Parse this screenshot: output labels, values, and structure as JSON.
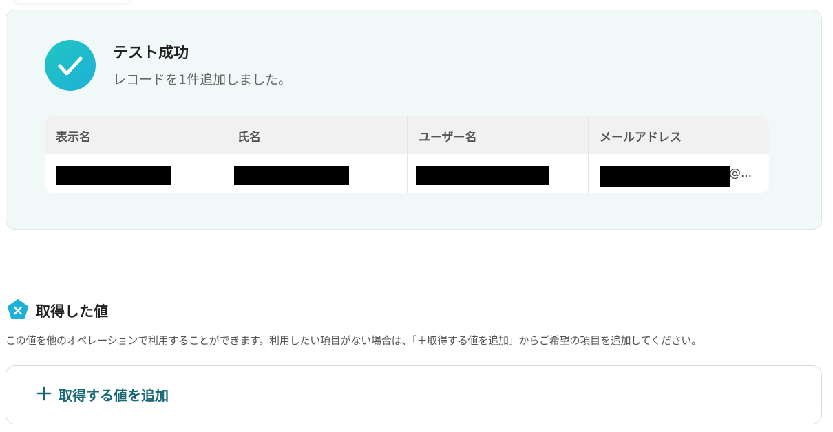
{
  "result": {
    "title": "テスト成功",
    "message": "レコードを1件追加しました。"
  },
  "table": {
    "columns": [
      "表示名",
      "氏名",
      "ユーザー名",
      "メールアドレス"
    ],
    "rows": [
      {
        "email_suffix": "@..."
      }
    ]
  },
  "values_section": {
    "title": "取得した値",
    "description": "この値を他のオペレーションで利用することができます。利用したい項目がない場合は、「＋取得する値を追加」からご希望の項目を追加してください。",
    "add_button_label": "取得する値を追加"
  },
  "colors": {
    "accent_teal": "#1fb8cf",
    "add_button_text": "#186877",
    "card_background": "#f1f8f8"
  },
  "icons": {
    "success": "check-circle-icon",
    "values": "pentagon-x-icon",
    "add": "plus-icon"
  }
}
